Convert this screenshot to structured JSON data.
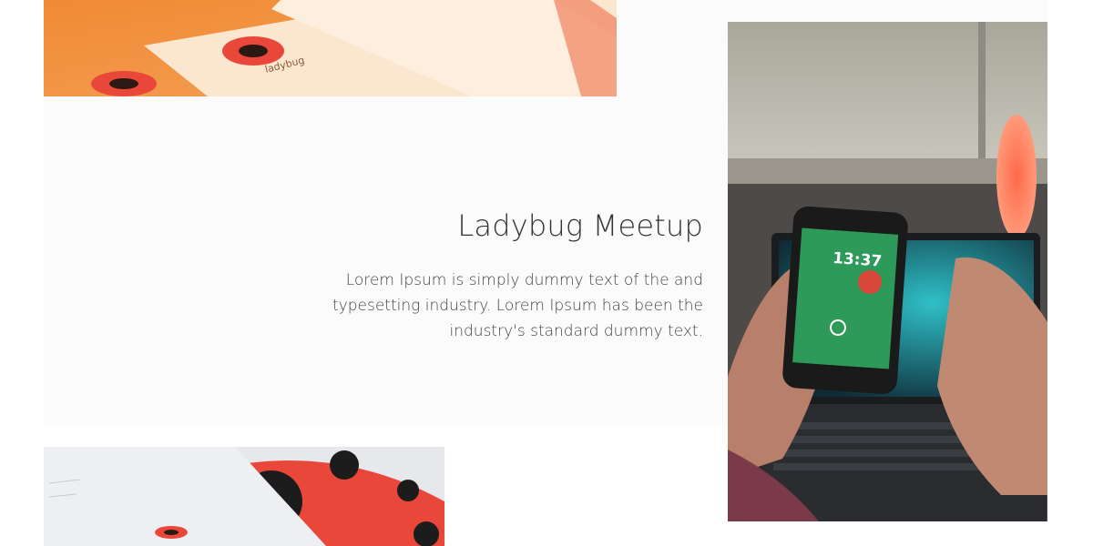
{
  "feature": {
    "title": "Ladybug Meetup",
    "body": "Lorem Ipsum is simply dummy text of the and typesetting industry. Lorem Ipsum has been the industry's standard dummy text."
  },
  "images": {
    "top": {
      "icon": "ladybug-stationery-photo"
    },
    "bottom": {
      "icon": "ladybug-envelope-photo"
    },
    "right": {
      "icon": "phone-in-hands-photo",
      "phone_clock": "13:37"
    }
  },
  "colors": {
    "accent_red": "#e8473a",
    "phone_green": "#2e9a5a",
    "background": "#fbfbfb"
  }
}
